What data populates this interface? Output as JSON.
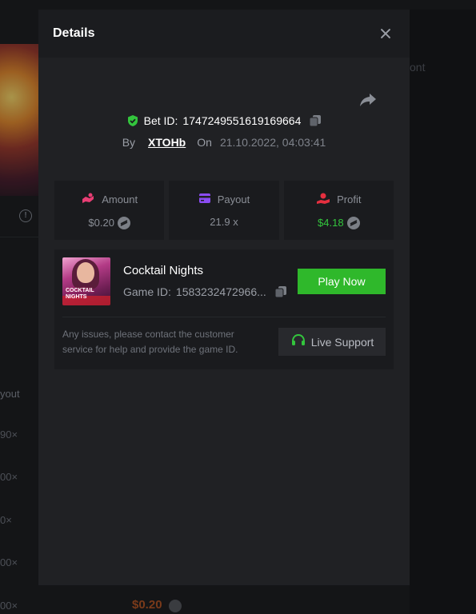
{
  "modal": {
    "title": "Details",
    "bet_id_label": "Bet ID:",
    "bet_id_value": "1747249551619169664",
    "by_label": "By",
    "username": "XTOHb",
    "on_label": "On",
    "datetime": "21.10.2022, 04:03:41"
  },
  "stats": {
    "amount": {
      "label": "Amount",
      "value": "$0.20"
    },
    "payout": {
      "label": "Payout",
      "value": "21.9 x"
    },
    "profit": {
      "label": "Profit",
      "value": "$4.18"
    }
  },
  "game": {
    "name": "Cocktail Nights",
    "id_label": "Game ID:",
    "id_value": "1583232472966...",
    "thumb_text": "COCKTAIL NIGHTS",
    "play_label": "Play Now",
    "note": "Any issues, please contact the customer service for help and provide the game ID.",
    "support_label": "Live Support"
  },
  "background": {
    "col_head": "yout",
    "rows": [
      "90×",
      "00×",
      "0×",
      "00×",
      "00×"
    ],
    "ghost_text": "ont",
    "amount": "$0.20"
  },
  "colors": {
    "accent_green": "#2fb82b",
    "profit_green": "#33c53d",
    "amount_icon": "#e83e74",
    "payout_icon": "#8b4cf3",
    "profit_icon": "#e52f3f"
  },
  "icons": {
    "close": "close-icon",
    "share": "share-icon",
    "shield": "shield-check-icon",
    "copy": "copy-icon",
    "coin": "coin-icon",
    "headset": "headset-icon"
  }
}
